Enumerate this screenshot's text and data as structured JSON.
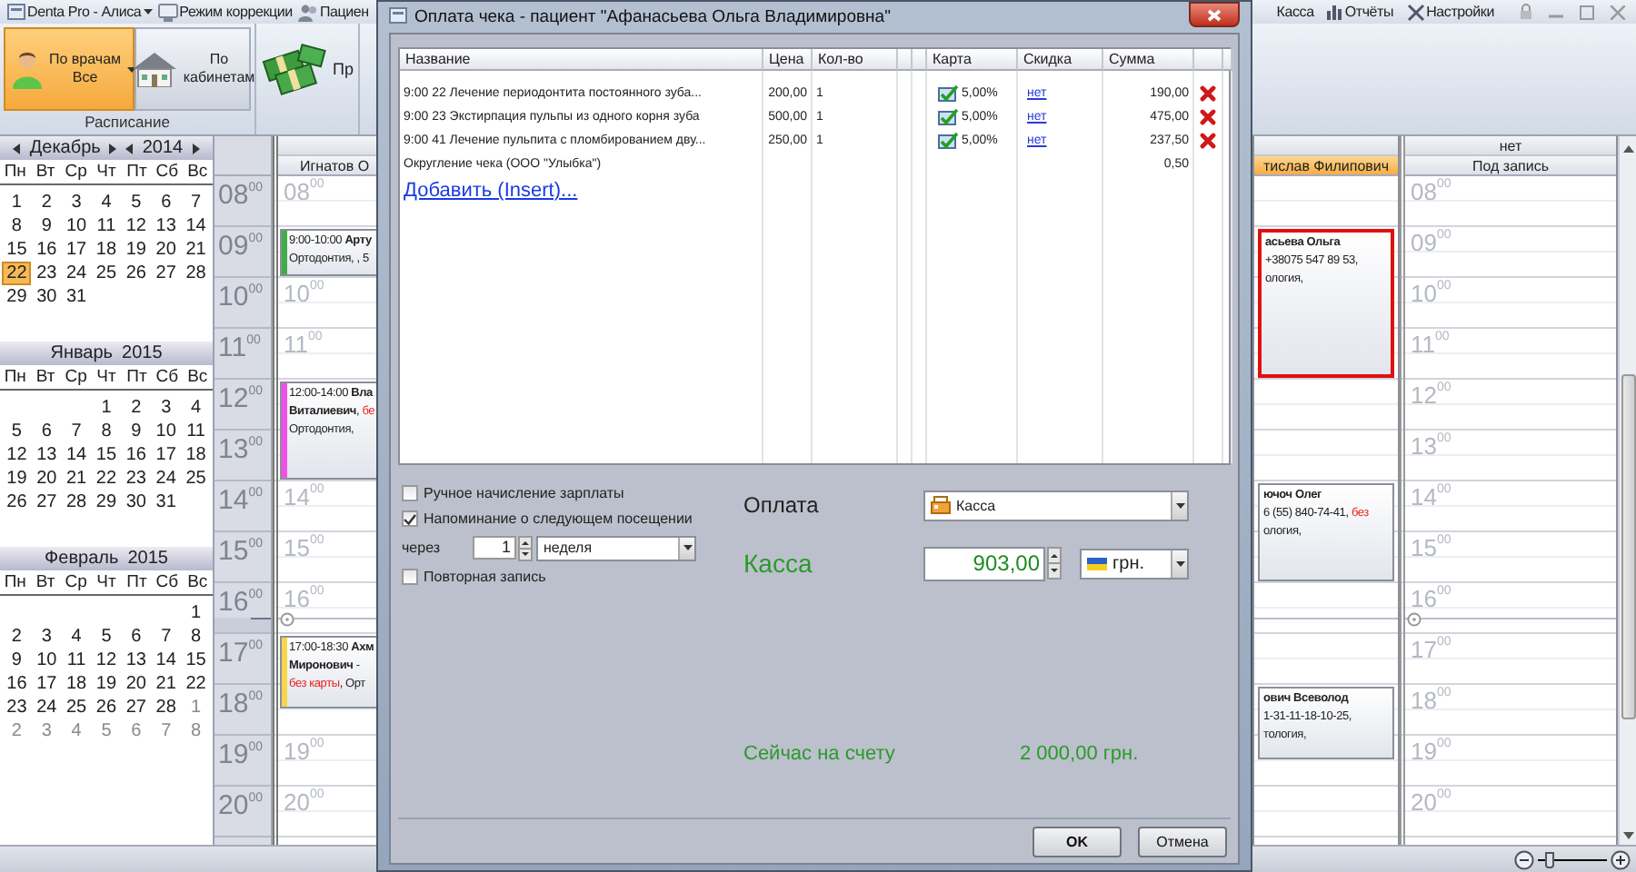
{
  "titlebar": {
    "left": [
      {
        "dropdown": true,
        "label": "Denta Pro - Алиса"
      },
      {
        "dropdown": false,
        "label": "Режим коррекции"
      },
      {
        "dropdown": false,
        "label": "Пациен"
      }
    ],
    "right": [
      {
        "label": "Касса"
      },
      {
        "label": "Отчёты"
      },
      {
        "label": "Настройки"
      }
    ]
  },
  "ribbon": {
    "groups": [
      {
        "caption": "Расписание",
        "buttons": [
          {
            "lines": [
              "По врачам",
              "Все"
            ],
            "selected": true,
            "dropdown": true
          },
          {
            "lines": [
              "По",
              "кабинетам"
            ],
            "selected": false,
            "dropdown": false
          }
        ]
      },
      {
        "buttons": [
          {
            "lines": [
              "Пр"
            ],
            "selected": false,
            "dropdown": false
          }
        ]
      }
    ]
  },
  "sidebar": {
    "calendars": [
      {
        "month": "Декабрь",
        "year": "2014",
        "navigation": true,
        "weekdays": [
          "Пн",
          "Вт",
          "Ср",
          "Чт",
          "Пт",
          "Сб",
          "Вс"
        ],
        "weeks": [
          [
            {
              "d": "1",
              "selected": false
            },
            {
              "d": "2",
              "selected": false
            },
            {
              "d": "3",
              "selected": false
            },
            {
              "d": "4",
              "selected": false
            },
            {
              "d": "5",
              "selected": false
            },
            {
              "d": "6",
              "selected": false
            },
            {
              "d": "7",
              "selected": false
            }
          ],
          [
            {
              "d": "8",
              "selected": false
            },
            {
              "d": "9",
              "selected": false
            },
            {
              "d": "10",
              "selected": false
            },
            {
              "d": "11",
              "selected": false
            },
            {
              "d": "12",
              "selected": false
            },
            {
              "d": "13",
              "selected": false
            },
            {
              "d": "14",
              "selected": false
            }
          ],
          [
            {
              "d": "15",
              "selected": false
            },
            {
              "d": "16",
              "selected": false
            },
            {
              "d": "17",
              "selected": false
            },
            {
              "d": "18",
              "selected": false
            },
            {
              "d": "19",
              "selected": false
            },
            {
              "d": "20",
              "selected": false
            },
            {
              "d": "21",
              "selected": false
            }
          ],
          [
            {
              "d": "22",
              "selected": true
            },
            {
              "d": "23",
              "selected": false
            },
            {
              "d": "24",
              "selected": false
            },
            {
              "d": "25",
              "selected": false
            },
            {
              "d": "26",
              "selected": false
            },
            {
              "d": "27",
              "selected": false
            },
            {
              "d": "28",
              "selected": false
            }
          ],
          [
            {
              "d": "29",
              "selected": false
            },
            {
              "d": "30",
              "selected": false
            },
            {
              "d": "31",
              "selected": false
            }
          ]
        ]
      },
      {
        "month": "Январь",
        "year": "2015",
        "navigation": false,
        "weekdays": [
          "Пн",
          "Вт",
          "Ср",
          "Чт",
          "Пт",
          "Сб",
          "Вс"
        ],
        "weeks": [
          [
            {
              "d": "1",
              "selected": false
            },
            {
              "d": "2",
              "selected": false
            },
            {
              "d": "3",
              "selected": false
            },
            {
              "d": "4",
              "selected": false
            }
          ],
          [
            {
              "d": "5",
              "selected": false
            },
            {
              "d": "6",
              "selected": false
            },
            {
              "d": "7",
              "selected": false
            },
            {
              "d": "8",
              "selected": false
            },
            {
              "d": "9",
              "selected": false
            },
            {
              "d": "10",
              "selected": false
            },
            {
              "d": "11",
              "selected": false
            }
          ],
          [
            {
              "d": "12",
              "selected": false
            },
            {
              "d": "13",
              "selected": false
            },
            {
              "d": "14",
              "selected": false
            },
            {
              "d": "15",
              "selected": false
            },
            {
              "d": "16",
              "selected": false
            },
            {
              "d": "17",
              "selected": false
            },
            {
              "d": "18",
              "selected": false
            }
          ],
          [
            {
              "d": "19",
              "selected": false
            },
            {
              "d": "20",
              "selected": false
            },
            {
              "d": "21",
              "selected": false
            },
            {
              "d": "22",
              "selected": false
            },
            {
              "d": "23",
              "selected": false
            },
            {
              "d": "24",
              "selected": false
            },
            {
              "d": "25",
              "selected": false
            }
          ],
          [
            {
              "d": "26",
              "selected": false
            },
            {
              "d": "27",
              "selected": false
            },
            {
              "d": "28",
              "selected": false
            },
            {
              "d": "29",
              "selected": false
            },
            {
              "d": "30",
              "selected": false
            },
            {
              "d": "31",
              "selected": false
            }
          ]
        ]
      },
      {
        "month": "Февраль",
        "year": "2015",
        "navigation": false,
        "weekdays": [
          "Пн",
          "Вт",
          "Ср",
          "Чт",
          "Пт",
          "Сб",
          "Вс"
        ],
        "weeks": [
          [
            {
              "d": "1",
              "selected": false
            }
          ],
          [
            {
              "d": "2",
              "selected": false
            },
            {
              "d": "3",
              "selected": false
            },
            {
              "d": "4",
              "selected": false
            },
            {
              "d": "5",
              "selected": false
            },
            {
              "d": "6",
              "selected": false
            },
            {
              "d": "7",
              "selected": false
            },
            {
              "d": "8",
              "selected": false
            }
          ],
          [
            {
              "d": "9",
              "selected": false
            },
            {
              "d": "10",
              "selected": false
            },
            {
              "d": "11",
              "selected": false
            },
            {
              "d": "12",
              "selected": false
            },
            {
              "d": "13",
              "selected": false
            },
            {
              "d": "14",
              "selected": false
            },
            {
              "d": "15",
              "selected": false
            }
          ],
          [
            {
              "d": "16",
              "selected": false
            },
            {
              "d": "17",
              "selected": false
            },
            {
              "d": "18",
              "selected": false
            },
            {
              "d": "19",
              "selected": false
            },
            {
              "d": "20",
              "selected": false
            },
            {
              "d": "21",
              "selected": false
            },
            {
              "d": "22",
              "selected": false
            }
          ],
          [
            {
              "d": "23",
              "selected": false
            },
            {
              "d": "24",
              "selected": false
            },
            {
              "d": "25",
              "selected": false
            },
            {
              "d": "26",
              "selected": false
            },
            {
              "d": "27",
              "selected": false
            },
            {
              "d": "28",
              "selected": false
            }
          ]
        ],
        "next_month_days": [
          "1",
          "2",
          "3",
          "4",
          "5",
          "6",
          "7",
          "8"
        ]
      }
    ]
  },
  "schedule": {
    "time_rows": [
      {
        "label": "08$^{00}$",
        "current": false
      },
      {
        "label": "09$^{00}$",
        "current": false
      },
      {
        "label": "10$^{00}$",
        "current": false
      },
      {
        "label": "11$^{00}$",
        "current": false
      },
      {
        "label": "12$^{00}$",
        "current": false
      },
      {
        "label": "13$^{00}$",
        "current": false
      },
      {
        "label": "14$^{00}$",
        "current": false
      },
      {
        "label": "15$^{00}$",
        "current": false
      },
      {
        "label": "16$^{00}$",
        "current": true
      },
      {
        "label": "17$^{00}$",
        "current": false
      },
      {
        "label": "18$^{00}$",
        "current": false
      },
      {
        "label": "19$^{00}$",
        "current": false
      },
      {
        "label": "20$^{00}$",
        "current": false
      }
    ],
    "columns": [
      {
        "name": "Игнатов О",
        "selected": false,
        "slots": [
          {
            "kind": "free",
            "mark": "08$^{00}$"
          },
          {
            "kind": "appointment",
            "color": "#3fae49",
            "selected": false,
            "lines": [
              [
                {
                  "text": "9:00-10:00 ",
                  "kind": "plain"
                },
                {
                  "text": "Арту",
                  "kind": "bold"
                }
              ],
              [
                {
                  "text": "Ортодонтия, , 5",
                  "kind": "plain"
                }
              ]
            ]
          },
          {
            "kind": "free",
            "mark": "10$^{00}$"
          },
          {
            "kind": "free",
            "mark": "11$^{00}$"
          },
          {
            "kind": "appointment",
            "color": "#f050e6",
            "selected": false,
            "lines": [
              [
                {
                  "text": "12:00-14:00 ",
                  "kind": "plain"
                },
                {
                  "text": "Вла",
                  "kind": "bold"
                }
              ],
              [
                {
                  "text": "Виталиевич",
                  "kind": "bold"
                },
                {
                  "text": ", ",
                  "kind": "plain"
                },
                {
                  "text": "бе",
                  "kind": "warning"
                }
              ],
              [
                {
                  "text": "Ортодонтия,",
                  "kind": "plain"
                }
              ]
            ]
          },
          {
            "kind": "busy"
          },
          {
            "kind": "free",
            "mark": "14$^{00}$"
          },
          {
            "kind": "free",
            "mark": "15$^{00}$"
          },
          {
            "kind": "free",
            "mark": "16$^{00}$"
          },
          {
            "kind": "appointment",
            "color": "#f7d74a",
            "selected": false,
            "lines": [
              [
                {
                  "text": "17:00-18:30 ",
                  "kind": "plain"
                },
                {
                  "text": "Ахм",
                  "kind": "bold"
                }
              ],
              [
                {
                  "text": "Миронович",
                  "kind": "bold"
                },
                {
                  "text": " - ",
                  "kind": "plain"
                }
              ],
              [
                {
                  "text": "без карты",
                  "kind": "warning"
                },
                {
                  "text": ", Орт",
                  "kind": "plain"
                }
              ]
            ]
          },
          {
            "kind": "half_busy"
          },
          {
            "kind": "free",
            "mark": "19$^{00}$"
          },
          {
            "kind": "free",
            "mark": "20$^{00}$"
          }
        ]
      },
      {
        "name": "тислав Филипович",
        "selected": true,
        "slots": [
          {
            "kind": "free"
          },
          {
            "kind": "appointment",
            "selected": true,
            "lines": [
              [
                {
                  "text": "асьева Ольга",
                  "kind": "bold"
                }
              ],
              [
                {
                  "text": "+38075 547 89 53,",
                  "kind": "plain"
                }
              ],
              [
                {
                  "text": "ология,",
                  "kind": "plain"
                }
              ]
            ]
          },
          {
            "kind": "busy"
          },
          {
            "kind": "busy"
          },
          {
            "kind": "free"
          },
          {
            "kind": "free"
          },
          {
            "kind": "appointment",
            "selected": false,
            "lines": [
              [
                {
                  "text": "ючоч Олег",
                  "kind": "bold"
                }
              ],
              [
                {
                  "text": "6 (55) 840-74-41, ",
                  "kind": "plain"
                },
                {
                  "text": "без",
                  "kind": "warning"
                }
              ],
              [
                {
                  "text": "ология,",
                  "kind": "plain"
                }
              ]
            ]
          },
          {
            "kind": "busy"
          },
          {
            "kind": "free"
          },
          {
            "kind": "free"
          },
          {
            "kind": "appointment",
            "selected": false,
            "lines": [
              [
                {
                  "text": "ович Всеволод",
                  "kind": "bold"
                }
              ],
              [
                {
                  "text": "1-31-11-18-10-25,",
                  "kind": "plain"
                }
              ],
              [
                {
                  "text": "тология,",
                  "kind": "plain"
                }
              ]
            ]
          },
          {
            "kind": "half_busy"
          },
          {
            "kind": "free"
          }
        ]
      },
      {
        "group": "нет",
        "name": "Под запись",
        "selected": false,
        "slots": [
          {
            "kind": "free",
            "mark": "08$^{00}$"
          },
          {
            "kind": "free",
            "mark": "09$^{00}$"
          },
          {
            "kind": "free",
            "mark": "10$^{00}$"
          },
          {
            "kind": "free",
            "mark": "11$^{00}$"
          },
          {
            "kind": "free",
            "mark": "12$^{00}$"
          },
          {
            "kind": "free",
            "mark": "13$^{00}$"
          },
          {
            "kind": "free",
            "mark": "14$^{00}$"
          },
          {
            "kind": "free",
            "mark": "15$^{00}$"
          },
          {
            "kind": "free",
            "mark": "16$^{00}$"
          },
          {
            "kind": "free",
            "mark": "17$^{00}$"
          },
          {
            "kind": "free",
            "mark": "18$^{00}$"
          },
          {
            "kind": "free",
            "mark": "19$^{00}$"
          },
          {
            "kind": "free",
            "mark": "20$^{00}$"
          }
        ]
      }
    ]
  },
  "dialog": {
    "title": "Оплата чека - пациент \"Афанасьева Ольга Владимировна\"",
    "table": {
      "columns": [
        "Название",
        "Цена",
        "Кол-во",
        "Карта",
        "Скидка",
        "Сумма"
      ],
      "rows": [
        {
          "kind": "service",
          "name": "9:00 22 Лечение периодонтита постоянного зуба...",
          "price": "200,00",
          "qty": "1",
          "card": {
            "checked": true,
            "text": "5,00%"
          },
          "discount": "нет",
          "sum": "190,00"
        },
        {
          "kind": "service",
          "name": "9:00 23 Экстирпация пульпы из одного корня зуба",
          "price": "500,00",
          "qty": "1",
          "card": {
            "checked": true,
            "text": "5,00%"
          },
          "discount": "нет",
          "sum": "475,00"
        },
        {
          "kind": "service",
          "name": "9:00 41 Лечение пульпита с пломбированием дву...",
          "price": "250,00",
          "qty": "1",
          "card": {
            "checked": true,
            "text": "5,00%"
          },
          "discount": "нет",
          "sum": "237,50"
        },
        {
          "kind": "rounding",
          "name": "Округление чека (ООО \"Улыбка\")",
          "sum": "0,50"
        }
      ],
      "add_link": "Добавить (Insert)..."
    },
    "options": {
      "salary_manual": {
        "label": "Ручное начисление зарплаты",
        "checked": false
      },
      "reminder": {
        "label": "Напоминание о следующем посещении",
        "checked": true,
        "after_label": "через",
        "count": "1",
        "unit": "неделя"
      },
      "repeat": {
        "label": "Повторная запись",
        "checked": false
      }
    },
    "payment": {
      "label": "Оплата",
      "method": "Касса",
      "amount_label": "Касса",
      "amount": "903,00",
      "currency": "грн."
    },
    "balance": {
      "label": "Сейчас на счету",
      "value": "2 000,00 грн."
    },
    "buttons": [
      {
        "kind": "default",
        "label": "OK"
      },
      {
        "kind": "cancel",
        "label": "Отмена"
      }
    ]
  },
  "status_bar": {
    "zoom": {
      "level": 0.1
    }
  }
}
